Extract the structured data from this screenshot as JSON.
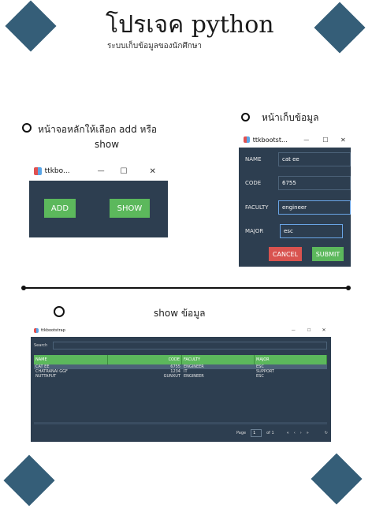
{
  "header": {
    "title": "โปรเจค python",
    "subtitle": "ระบบเก็บข้อมูลของนักศึกษา"
  },
  "section_main": {
    "caption_line1": "หน้าจอหลักให้เลือก add หรือ",
    "caption_line2": "show",
    "window_title": "ttkbo...",
    "add_label": "ADD",
    "show_label": "SHOW"
  },
  "section_form": {
    "caption": "หน้าเก็บข้อมูล",
    "window_title": "ttkbootst...",
    "fields": [
      {
        "label": "NAME",
        "value": "cat ee"
      },
      {
        "label": "CODE",
        "value": "6755"
      },
      {
        "label": "FACULTY",
        "value": "engineer"
      },
      {
        "label": "MAJOR",
        "value": "esc"
      }
    ],
    "cancel_label": "CANCEL",
    "submit_label": "SUBMIT"
  },
  "section_show": {
    "caption": "show ข้อมูล",
    "window_title": "ttkbootstrap",
    "search_label": "Search",
    "columns": [
      "NAME",
      "CODE",
      "FACULTY",
      "MAJOR"
    ],
    "rows": [
      [
        "CAT EE",
        "6755",
        "ENGINEER",
        "ESC"
      ],
      [
        "CHATRANAI GGF",
        "1234",
        "IT",
        "SUPPORT"
      ],
      [
        "NUTTAPUT",
        "GUNXUT",
        "ENGINEER",
        "ESC"
      ]
    ],
    "page_label": "Page",
    "page_value": "1",
    "page_of": "of 1"
  },
  "window_controls": {
    "minimize": "—",
    "maximize": "☐",
    "close": "✕"
  },
  "colors": {
    "accent": "#355e78",
    "window_bg": "#2d3e50",
    "success": "#5cb85c",
    "danger": "#d9534f"
  }
}
